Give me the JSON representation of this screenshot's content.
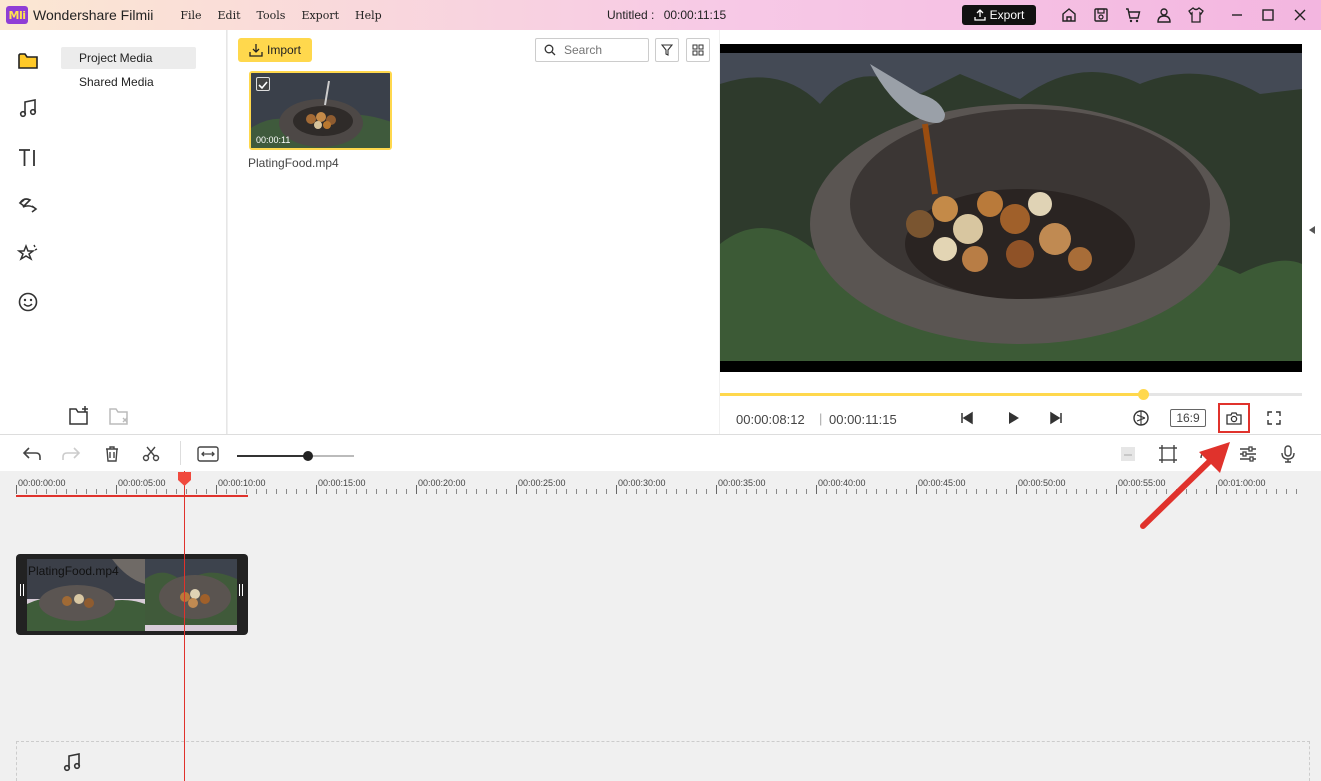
{
  "app": {
    "logo_text": "Mli",
    "name": "Wondershare Filmii",
    "menu": [
      "File",
      "Edit",
      "Tools",
      "Export",
      "Help"
    ],
    "doc_title": "Untitled :",
    "doc_duration": "00:00:11:15",
    "export_label": "Export",
    "title_icons": [
      "home-icon",
      "save-icon",
      "cart-icon",
      "user-icon",
      "shirt-icon",
      "minimize-icon",
      "maximize-icon",
      "close-icon"
    ]
  },
  "sidebar": {
    "icons": [
      "folder-icon",
      "music-icon",
      "text-icon",
      "transition-icon",
      "effects-icon",
      "sticker-icon"
    ]
  },
  "categories": [
    {
      "label": "Project Media",
      "active": true
    },
    {
      "label": "Shared Media",
      "active": false
    }
  ],
  "library": {
    "import_label": "Import",
    "search_placeholder": "Search",
    "items": [
      {
        "name": "PlatingFood.mp4",
        "duration": "00:00:11",
        "checked": true
      }
    ]
  },
  "preview": {
    "current_time": "00:00:08:12",
    "separator": "|",
    "total_time": "00:00:11:15",
    "progress": 0.727,
    "aspect_ratio": "16:9"
  },
  "toolbar": {
    "zoom_level": 0.61
  },
  "timeline": {
    "ticks": [
      "00:00:00:00",
      "00:00:05:00",
      "00:00:10:00",
      "00:00:15:00",
      "00:00:20:00",
      "00:00:25:00",
      "00:00:30:00",
      "00:00:35:00",
      "00:00:40:00",
      "00:00:45:00",
      "00:00:50:00",
      "00:00:55:00",
      "00:01:00:00"
    ],
    "clip": {
      "name": "PlatingFood.mp4"
    }
  },
  "colors": {
    "accent_yellow": "#ffd84d",
    "highlight_red": "#e0322c"
  }
}
